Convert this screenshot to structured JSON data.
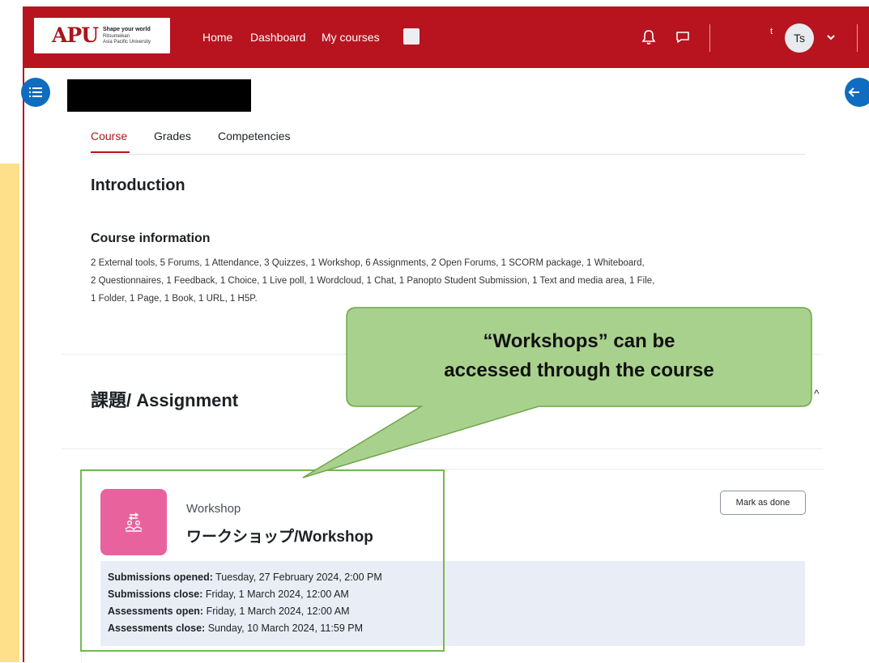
{
  "navbar": {
    "logo": {
      "mark": "APU",
      "tagline": "Shape your world",
      "sub1": "Ritsumeikan",
      "sub2": "Asia Pacific University"
    },
    "links": [
      "Home",
      "Dashboard",
      "My courses"
    ],
    "user_initial": "t",
    "avatar": "Ts",
    "colors": {
      "brand": "#b7141f"
    }
  },
  "tabs": [
    "Course",
    "Grades",
    "Competencies"
  ],
  "intro": {
    "heading": "Introduction",
    "info_heading": "Course information",
    "info_lines": [
      "2 External tools, 5 Forums, 1 Attendance, 3 Quizzes, 1 Workshop, 6 Assignments, 2 Open Forums, 1 SCORM package, 1 Whiteboard,",
      "2 Questionnaires, 1 Feedback, 1 Choice, 1 Live poll, 1 Wordcloud, 1 Chat, 1 Panopto Student Submission, 1 Text and media area, 1 File,",
      "1 Folder, 1 Page, 1 Book, 1 URL, 1 H5P."
    ]
  },
  "section": {
    "title": "課題/ Assignment"
  },
  "activity": {
    "type": "Workshop",
    "name": "ワークショップ/Workshop",
    "mark_done": "Mark as done",
    "dates": [
      {
        "label": "Submissions opened:",
        "value": "Tuesday, 27 February 2024, 2:00 PM"
      },
      {
        "label": "Submissions close:",
        "value": "Friday, 1 March 2024, 12:00 AM"
      },
      {
        "label": "Assessments open:",
        "value": "Friday, 1 March 2024, 12:00 AM"
      },
      {
        "label": "Assessments close:",
        "value": "Sunday, 10 March 2024, 11:59 PM"
      }
    ]
  },
  "callout": {
    "line1": "“Workshops” can be",
    "line2": "accessed through the course"
  }
}
